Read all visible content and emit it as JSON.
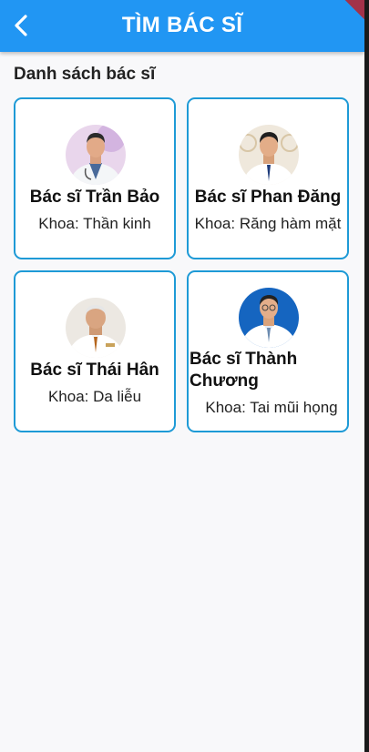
{
  "appbar": {
    "title": "TÌM BÁC SĨ",
    "back_icon": "chevron-left-icon",
    "color": "#2196f3"
  },
  "section": {
    "title": "Danh sách bác sĩ"
  },
  "doctors": [
    {
      "name": "Bác sĩ Trần Bảo",
      "department": "Khoa: Thần kinh"
    },
    {
      "name": "Bác sĩ Phan Đăng",
      "department": "Khoa: Răng hàm mặt"
    },
    {
      "name": "Bác sĩ Thái Hân",
      "department": "Khoa: Da liễu"
    },
    {
      "name": "Bác sĩ Thành Chương",
      "department": "Khoa: Tai mũi họng"
    }
  ],
  "colors": {
    "card_border": "#1e9ad6",
    "background": "#f8f8fa"
  }
}
